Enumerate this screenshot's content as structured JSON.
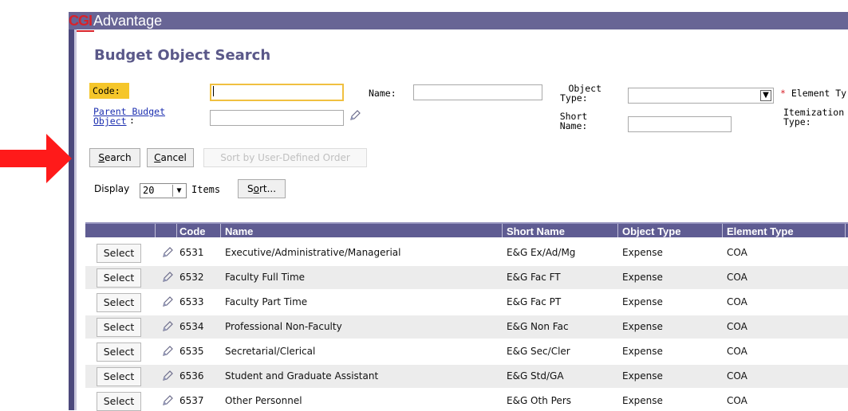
{
  "header": {
    "logo_cgi": "CGI",
    "logo_app": "Advantage"
  },
  "page": {
    "title": "Budget Object Search"
  },
  "form": {
    "code_label": "Code:",
    "parent_label_line1": "Parent Budget",
    "parent_label_line2": "Object",
    "parent_label_colon": ":",
    "name_label": "Name:",
    "object_type_line1": "Object",
    "object_type_line2": "Type:",
    "short_name_line1": "Short",
    "short_name_line2": "Name:",
    "element_type_req": "*",
    "element_type_label": "Element Ty",
    "itemization_line1": "Itemization",
    "itemization_line2": "Type:",
    "code_value": "",
    "name_value": "",
    "parent_value": "",
    "short_name_value": "",
    "object_type_selected": ""
  },
  "buttons": {
    "search_u": "S",
    "search_rest": "earch",
    "cancel_u": "C",
    "cancel_rest": "ancel",
    "sort_user_defined": "Sort by User-Defined Order",
    "sort_pre": "S",
    "sort_u": "o",
    "sort_rest": "rt..."
  },
  "display": {
    "label": "Display",
    "value": "20",
    "items_label": "Items"
  },
  "table": {
    "columns": [
      "Code",
      "Name",
      "Short Name",
      "Object Type",
      "Element Type"
    ],
    "select_label": "Select",
    "rows": [
      {
        "code": "6531",
        "name": "Executive/Administrative/Managerial",
        "short_name": "E&G Ex/Ad/Mg",
        "object_type": "Expense",
        "element_type": "COA"
      },
      {
        "code": "6532",
        "name": "Faculty Full Time",
        "short_name": "E&G Fac FT",
        "object_type": "Expense",
        "element_type": "COA"
      },
      {
        "code": "6533",
        "name": "Faculty Part Time",
        "short_name": "E&G Fac PT",
        "object_type": "Expense",
        "element_type": "COA"
      },
      {
        "code": "6534",
        "name": "Professional Non-Faculty",
        "short_name": "E&G Non Fac",
        "object_type": "Expense",
        "element_type": "COA"
      },
      {
        "code": "6535",
        "name": "Secretarial/Clerical",
        "short_name": "E&G Sec/Cler",
        "object_type": "Expense",
        "element_type": "COA"
      },
      {
        "code": "6536",
        "name": "Student and Graduate Assistant",
        "short_name": "E&G Std/GA",
        "object_type": "Expense",
        "element_type": "COA"
      },
      {
        "code": "6537",
        "name": "Other Personnel",
        "short_name": "E&G Oth Pers",
        "object_type": "Expense",
        "element_type": "COA"
      }
    ]
  },
  "colors": {
    "topbar": "#686595",
    "brand_red": "#d8222a",
    "header_purple": "#5f5c92",
    "highlight_yellow": "#f5c62a",
    "annotation_arrow": "#ff0000"
  },
  "icons": {
    "edit": "pencil-icon",
    "dropdown": "chevron-down-icon",
    "annotation": "red-arrow-icon"
  }
}
